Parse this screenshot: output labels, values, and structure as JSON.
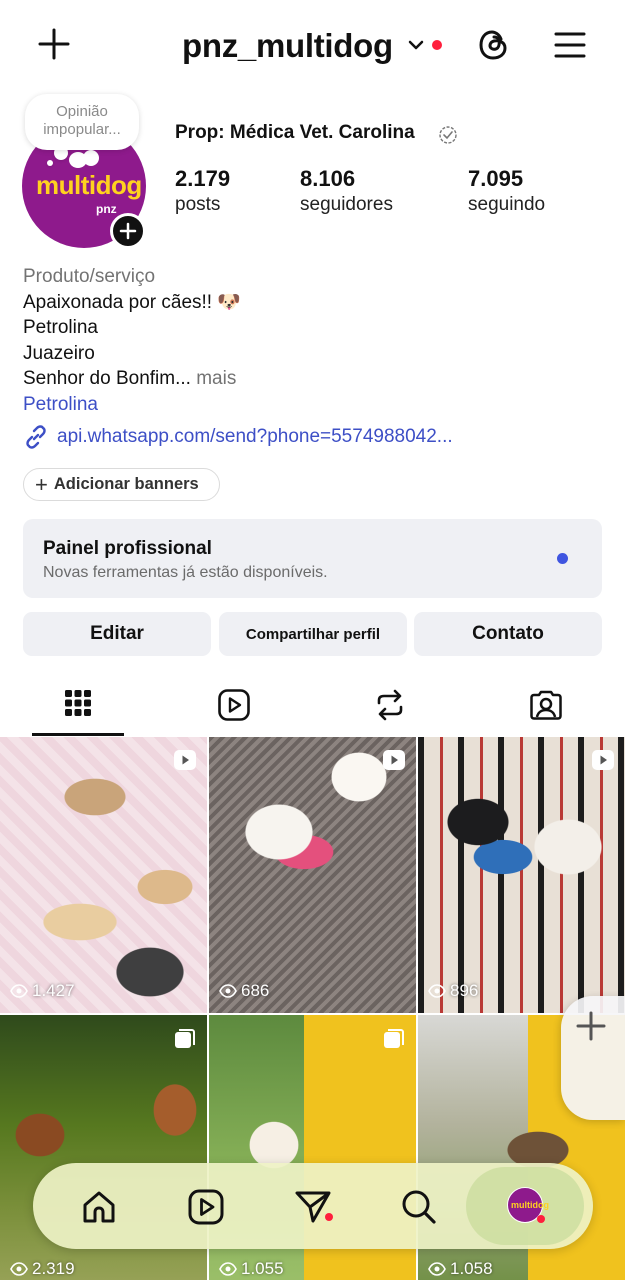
{
  "header": {
    "username": "pnz_multidog",
    "icons": [
      "plus-icon",
      "chevron-down-icon",
      "notification-dot",
      "threads-icon",
      "menu-icon"
    ]
  },
  "profile": {
    "note": "Opinião impopular...",
    "avatar_logo": "multidog",
    "avatar_sub": "pnz",
    "name": "Prop: Médica Vet.  Carolina",
    "stats": [
      {
        "value": "2.179",
        "label": "posts"
      },
      {
        "value": "8.106",
        "label": "seguidores"
      },
      {
        "value": "7.095",
        "label": "seguindo"
      }
    ],
    "category": "Produto/serviço",
    "bio_line1": "Apaixonada por cães!! 🐶",
    "bio_line2": "Petrolina",
    "bio_line3": "Juazeiro",
    "bio_line4": "Senhor do Bonfim...",
    "more": "mais",
    "location": "Petrolina",
    "link": "api.whatsapp.com/send?phone=5574988042..."
  },
  "banner_button": "Adicionar banners",
  "panel": {
    "title": "Painel profissional",
    "subtitle": "Novas ferramentas já estão disponíveis."
  },
  "actions": {
    "edit": "Editar",
    "share": "Compartilhar perfil",
    "contact": "Contato"
  },
  "tabs": [
    "grid-icon",
    "reels-icon",
    "reposts-icon",
    "tagged-icon"
  ],
  "grid": [
    {
      "views": "1.427",
      "type": "reel"
    },
    {
      "views": "686",
      "type": "reel"
    },
    {
      "views": "896",
      "type": "reel"
    },
    {
      "views": "2.319",
      "type": "carousel"
    },
    {
      "views": "1.055",
      "type": "carousel"
    },
    {
      "views": "1.058",
      "type": "video"
    }
  ],
  "bottom_nav": [
    "home-icon",
    "reels-icon",
    "direct-icon",
    "search-icon",
    "profile-avatar"
  ],
  "colors": {
    "link": "#3d4fc6",
    "notification": "#ff1f3d",
    "panel_bg": "#eff0f4",
    "avatar": "#8e1a8c"
  }
}
